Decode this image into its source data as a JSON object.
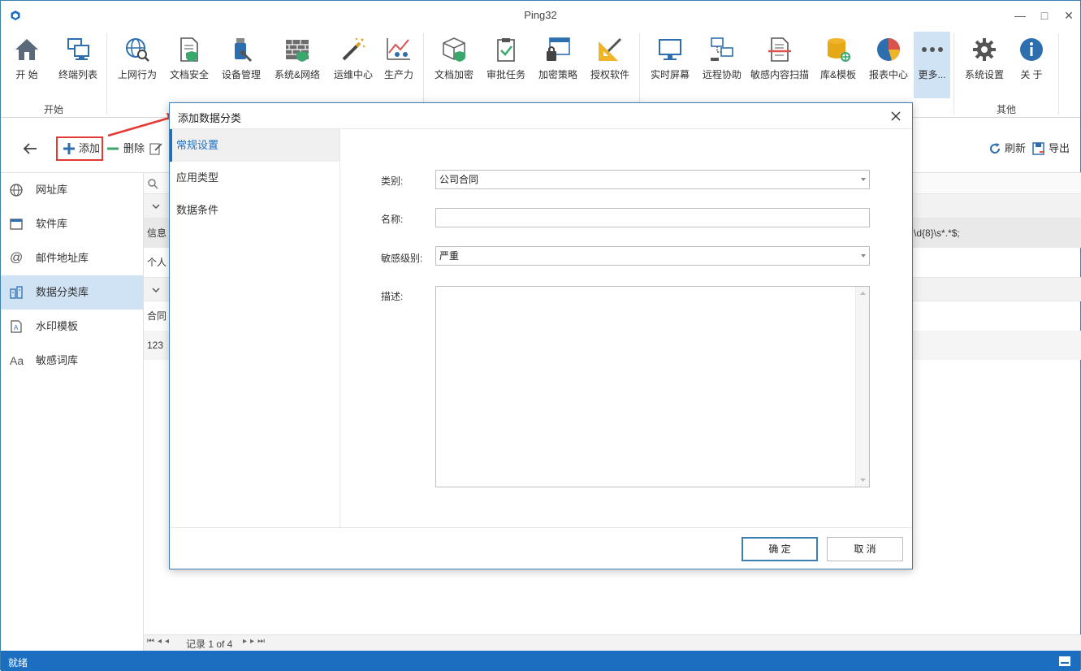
{
  "window": {
    "title": "Ping32"
  },
  "ribbon": {
    "buttons": [
      {
        "label": "开 始",
        "icon": "home-icon"
      },
      {
        "label": "终端列表",
        "icon": "computers-icon"
      },
      {
        "label": "上网行为",
        "icon": "globe-search-icon"
      },
      {
        "label": "文档安全",
        "icon": "document-shield-icon"
      },
      {
        "label": "设备管理",
        "icon": "usb-device-icon"
      },
      {
        "label": "系统&网络",
        "icon": "firewall-icon"
      },
      {
        "label": "运维中心",
        "icon": "magic-wand-icon"
      },
      {
        "label": "生产力",
        "icon": "chart-people-icon"
      },
      {
        "label": "文档加密",
        "icon": "box-shield-icon"
      },
      {
        "label": "审批任务",
        "icon": "clipboard-check-icon"
      },
      {
        "label": "加密策略",
        "icon": "window-lock-icon"
      },
      {
        "label": "授权软件",
        "icon": "ruler-pen-icon"
      },
      {
        "label": "实时屏幕",
        "icon": "monitor-icon"
      },
      {
        "label": "远程协助",
        "icon": "remote-network-icon"
      },
      {
        "label": "敏感内容扫描",
        "icon": "document-scan-icon"
      },
      {
        "label": "库&模板",
        "icon": "database-icon"
      },
      {
        "label": "报表中心",
        "icon": "pie-chart-icon"
      },
      {
        "label": "更多...",
        "icon": "more-dots-icon"
      },
      {
        "label": "系统设置",
        "icon": "gear-icon"
      },
      {
        "label": "关 于",
        "icon": "info-icon"
      }
    ],
    "groups": {
      "start": "开始",
      "other": "其他"
    }
  },
  "toolbar": {
    "add": "添加",
    "delete": "删除",
    "refresh": "刷新",
    "export": "导出"
  },
  "sidebar": {
    "items": [
      {
        "label": "网址库",
        "icon": "globe-icon"
      },
      {
        "label": "软件库",
        "icon": "window-icon"
      },
      {
        "label": "邮件地址库",
        "icon": "at-sign-icon"
      },
      {
        "label": "数据分类库",
        "icon": "data-category-icon"
      },
      {
        "label": "水印模板",
        "icon": "watermark-doc-icon"
      },
      {
        "label": "敏感词库",
        "icon": "font-aa-icon"
      }
    ]
  },
  "grid": {
    "rows": [
      {
        "text": "信息"
      },
      {
        "text": "个人"
      },
      {
        "text": "合同"
      },
      {
        "text": "123"
      }
    ],
    "regex_snippet": "\\d{8}\\s*.*$;"
  },
  "pager": {
    "text": "记录 1 of 4"
  },
  "status": {
    "text": "就绪"
  },
  "dialog": {
    "title": "添加数据分类",
    "nav": [
      "常规设置",
      "应用类型",
      "数据条件"
    ],
    "fields": {
      "category_label": "类别:",
      "category_value": "公司合同",
      "name_label": "名称:",
      "name_value": "",
      "level_label": "敏感级别:",
      "level_value": "严重",
      "desc_label": "描述:"
    },
    "ok": "确 定",
    "cancel": "取 消"
  },
  "colors": {
    "accent": "#1c6fc0",
    "highlight": "#e53935",
    "active_bg": "#cfe3f5"
  }
}
